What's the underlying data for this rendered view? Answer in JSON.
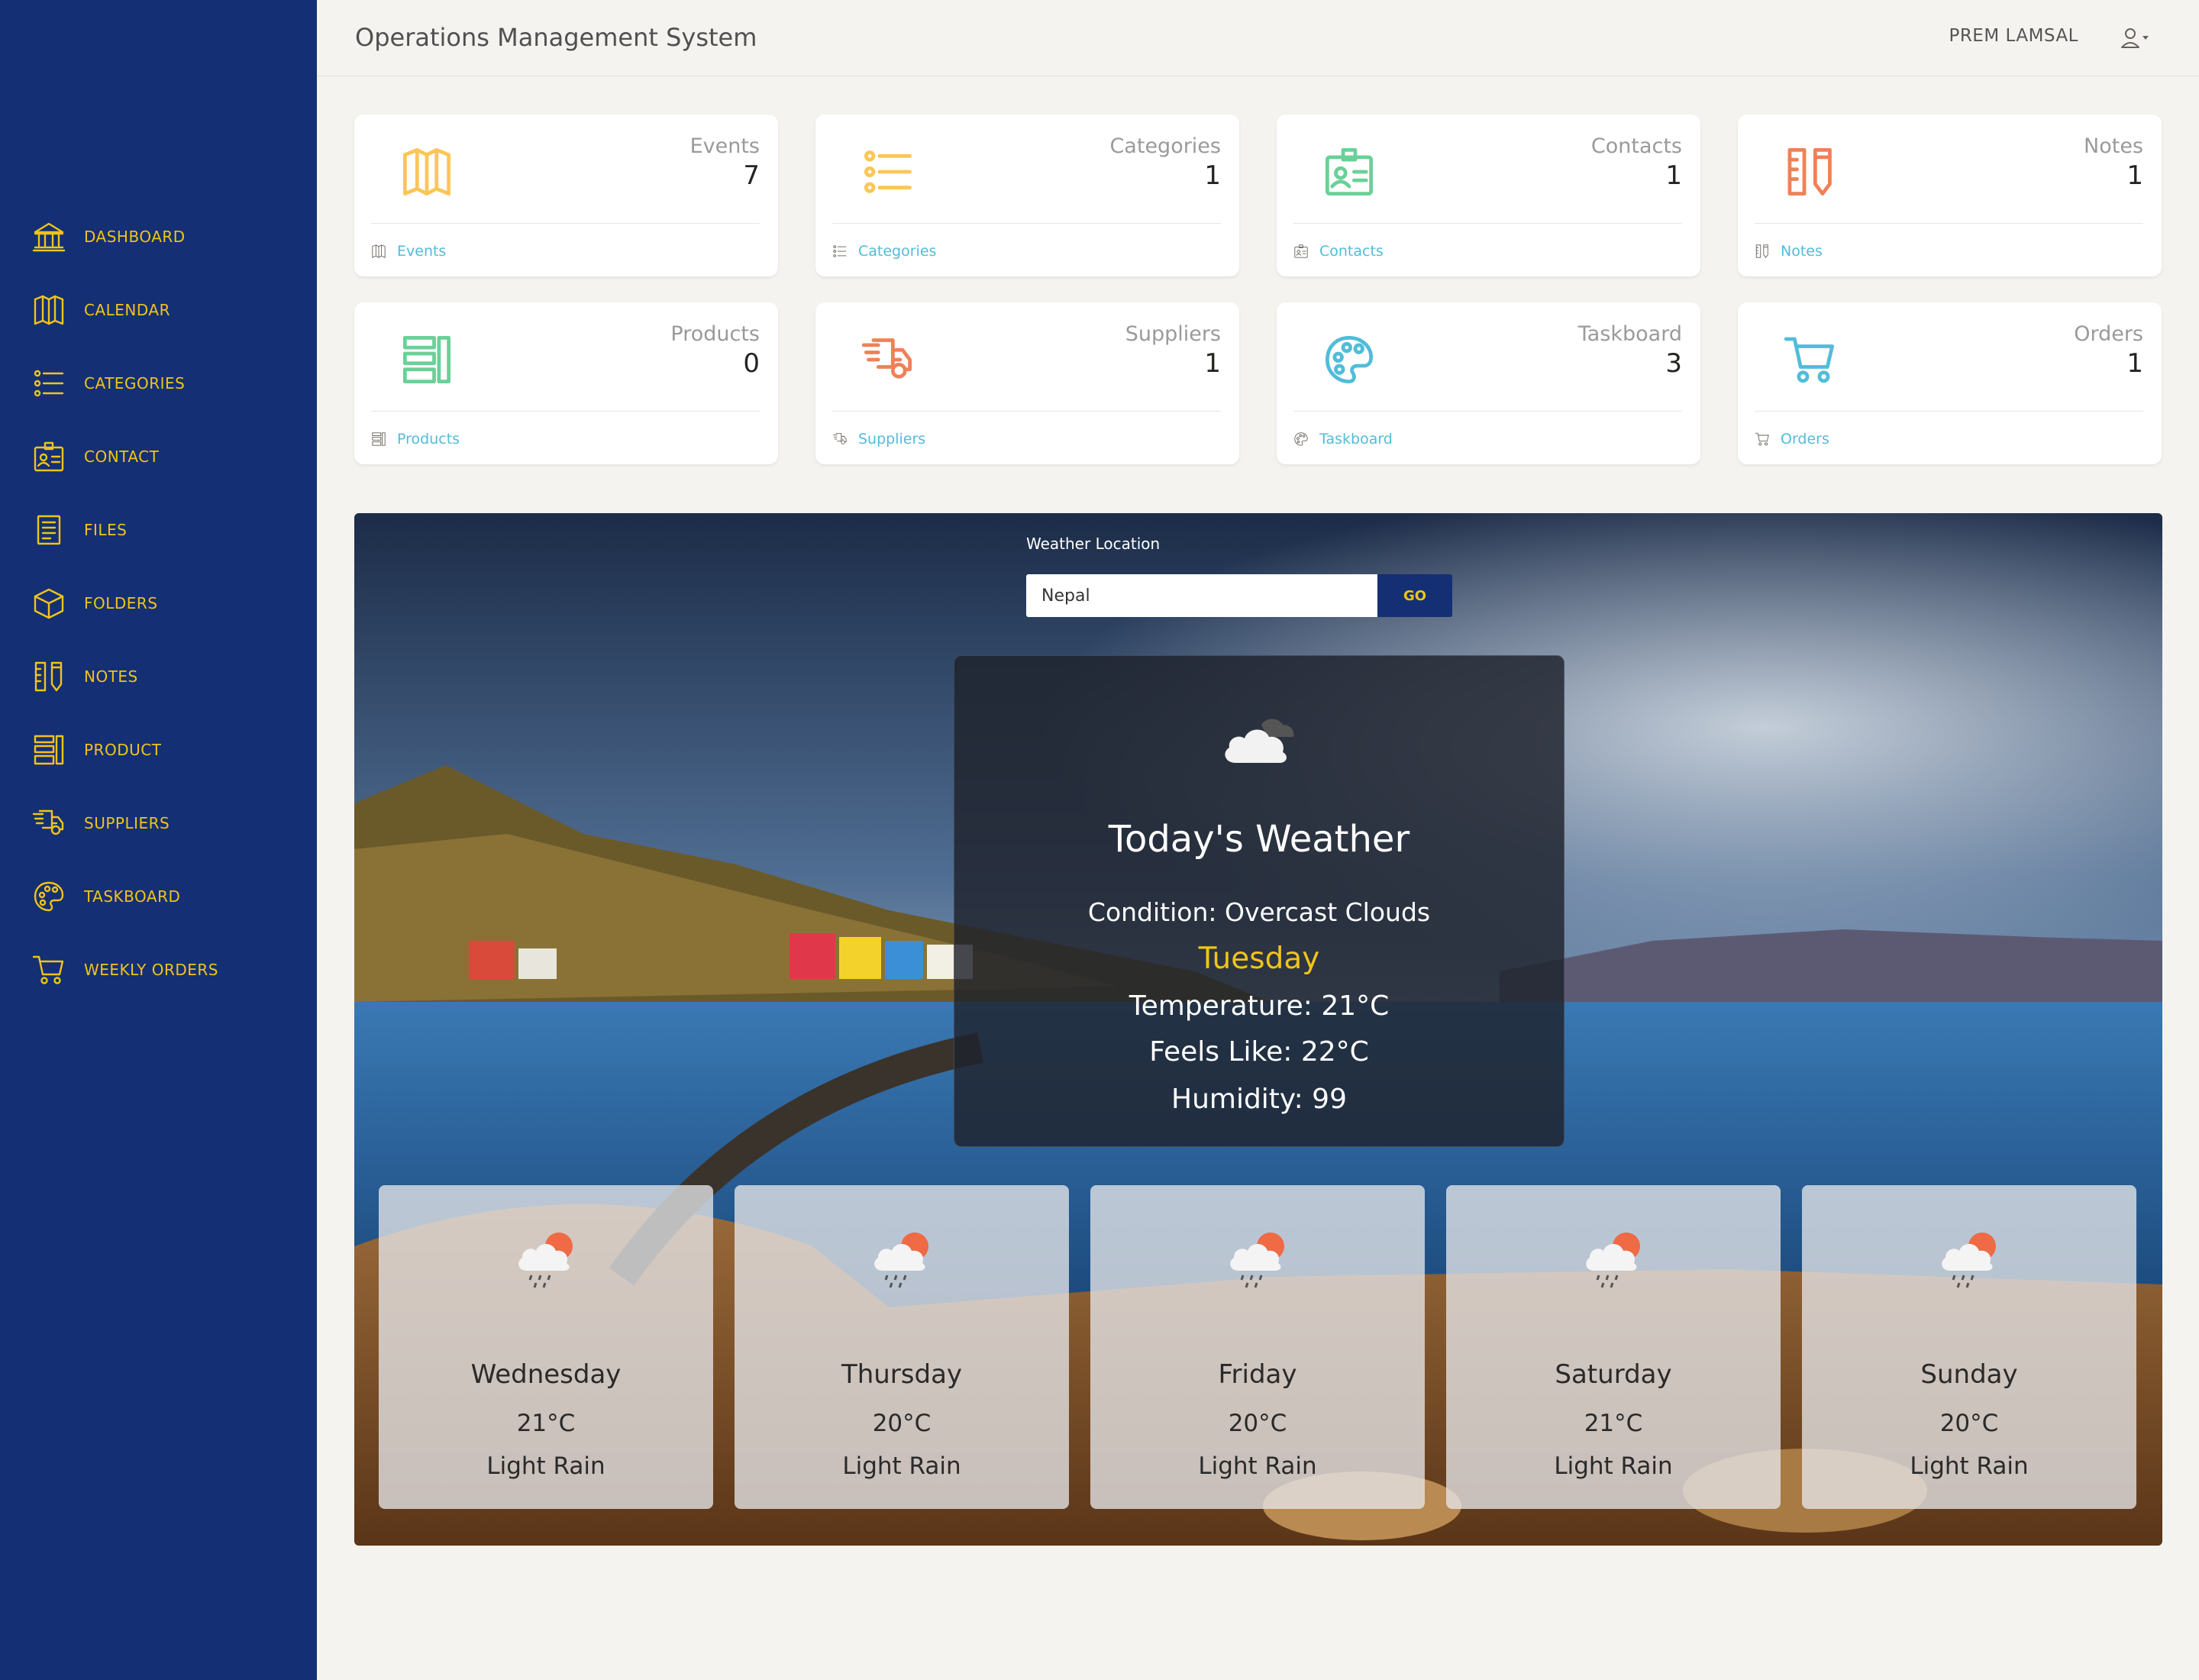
{
  "header": {
    "title": "Operations Management System",
    "user_name": "PREM LAMSAL",
    "user_menu_icon": "user-icon"
  },
  "sidebar": {
    "background_color": "#142f73",
    "accent_color": "#f0c419",
    "items": [
      {
        "label": "DASHBOARD",
        "icon": "bank-icon"
      },
      {
        "label": "CALENDAR",
        "icon": "map-icon"
      },
      {
        "label": "CATEGORIES",
        "icon": "list-icon"
      },
      {
        "label": "CONTACT",
        "icon": "badge-icon"
      },
      {
        "label": "FILES",
        "icon": "paper-icon"
      },
      {
        "label": "FOLDERS",
        "icon": "box-icon"
      },
      {
        "label": "NOTES",
        "icon": "ruler-pencil-icon"
      },
      {
        "label": "PRODUCT",
        "icon": "layout-icon"
      },
      {
        "label": "SUPPLIERS",
        "icon": "delivery-icon"
      },
      {
        "label": "TASKBOARD",
        "icon": "palette-icon"
      },
      {
        "label": "WEEKLY ORDERS",
        "icon": "cart-icon"
      }
    ]
  },
  "cards": [
    {
      "title": "Events",
      "count": "7",
      "link": "Events",
      "icon": "map-icon",
      "color": "#fbc658"
    },
    {
      "title": "Categories",
      "count": "1",
      "link": "Categories",
      "icon": "list-icon",
      "color": "#fbc658"
    },
    {
      "title": "Contacts",
      "count": "1",
      "link": "Contacts",
      "icon": "badge-icon",
      "color": "#6bd098"
    },
    {
      "title": "Notes",
      "count": "1",
      "link": "Notes",
      "icon": "ruler-pencil-icon",
      "color": "#ef8157"
    },
    {
      "title": "Products",
      "count": "0",
      "link": "Products",
      "icon": "layout-icon",
      "color": "#6bd098"
    },
    {
      "title": "Suppliers",
      "count": "1",
      "link": "Suppliers",
      "icon": "delivery-icon",
      "color": "#ef8157"
    },
    {
      "title": "Taskboard",
      "count": "3",
      "link": "Taskboard",
      "icon": "palette-icon",
      "color": "#51bcda"
    },
    {
      "title": "Orders",
      "count": "1",
      "link": "Orders",
      "icon": "cart-icon",
      "color": "#51bcda"
    }
  ],
  "weather": {
    "location_label": "Weather Location",
    "location_value": "Nepal",
    "go_label": "GO",
    "today": {
      "icon": "overcast-cloud-icon",
      "title": "Today's Weather",
      "condition": "Condition: Overcast Clouds",
      "day": "Tuesday",
      "temperature": "Temperature: 21°C",
      "feels_like": "Feels Like: 22°C",
      "humidity": "Humidity: 99"
    },
    "forecast": [
      {
        "day": "Wednesday",
        "temp": "21°C",
        "desc": "Light Rain",
        "icon": "rain-sun-icon"
      },
      {
        "day": "Thursday",
        "temp": "20°C",
        "desc": "Light Rain",
        "icon": "rain-sun-icon"
      },
      {
        "day": "Friday",
        "temp": "20°C",
        "desc": "Light Rain",
        "icon": "rain-sun-icon"
      },
      {
        "day": "Saturday",
        "temp": "21°C",
        "desc": "Light Rain",
        "icon": "rain-sun-icon"
      },
      {
        "day": "Sunday",
        "temp": "20°C",
        "desc": "Light Rain",
        "icon": "rain-sun-icon"
      }
    ]
  }
}
